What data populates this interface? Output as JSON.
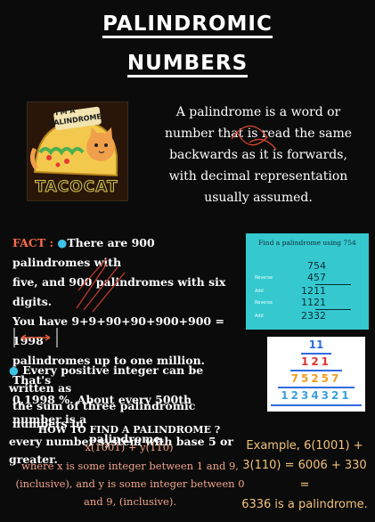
{
  "title": {
    "line1": "PALINDROMIC",
    "line2": "NUMBERS"
  },
  "tacocat": {
    "badge_line1": "I'M A",
    "badge_line2": "PALINDROME!",
    "label": "TACOCAT"
  },
  "definition": {
    "lines": [
      "A palindrome is a word or",
      "number that is read the same",
      "backwards as it is forwards,",
      "with decimal representation",
      "usually assumed."
    ]
  },
  "fact": {
    "label": "FACT :",
    "bullet": "●",
    "lines": [
      "There are 900 palindromes with",
      "five, and 900 palindromes with six digits.",
      "You have 9+9+90+90+900+900 = 1998",
      "palindromes up to one million. That's",
      "0,1998 %. About every 500th number is a",
      "palindrome."
    ]
  },
  "panel754": {
    "header": "Find a palindrome using 754",
    "rows": [
      {
        "label": "",
        "value": "754"
      },
      {
        "label": "Reverse",
        "value": "457"
      },
      {
        "label": "Add",
        "value": "1211"
      },
      {
        "label": "Reverse",
        "value": "1121"
      },
      {
        "label": "Add",
        "value": "2332"
      }
    ]
  },
  "pyramid": {
    "rows": [
      "11",
      "121",
      "75257",
      "1234321"
    ],
    "colors": [
      "#2f6be0",
      "#e0342f",
      "#f0a020",
      "#3aa0e0"
    ]
  },
  "every": {
    "bullet": "●",
    "lines": [
      "Every positive integer can be written as",
      "the sum of three palindromic numbers in",
      "every number system with base 5 or greater."
    ]
  },
  "howto": {
    "title": "HOW TO FIND A PALINDROME ?",
    "formula": "x(1001) + y(110)",
    "lines": [
      "where x is some integer between 1 and 9,",
      "(inclusive), and y is some integer between 0",
      "and 9, (inclusive)."
    ]
  },
  "example": {
    "lines": [
      "Example, 6(1001) +",
      "3(110) = 6006 + 330 =",
      "6336 is a palindrome."
    ]
  }
}
